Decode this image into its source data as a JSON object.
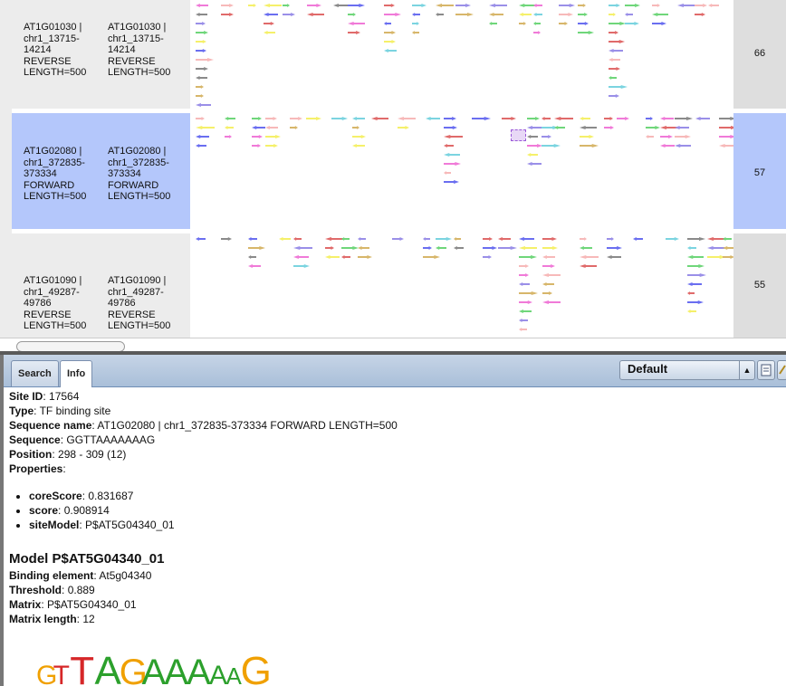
{
  "rows": [
    {
      "col1": [
        "AT1G01030 |",
        "chr1_13715-",
        "14214",
        "REVERSE",
        "LENGTH=500"
      ],
      "col2": [
        "AT1G01030 |",
        "chr1_13715-",
        "14214",
        "REVERSE",
        "LENGTH=500"
      ],
      "score": "66",
      "selected": false
    },
    {
      "col1": [
        "AT1G02080 |",
        "chr1_372835-",
        "373334",
        "FORWARD",
        "LENGTH=500"
      ],
      "col2": [
        "AT1G02080 |",
        "chr1_372835-",
        "373334",
        "FORWARD",
        "LENGTH=500"
      ],
      "score": "57",
      "selected": true
    },
    {
      "col1": [
        "AT1G01090 |",
        "chr1_49287-",
        "49786",
        "REVERSE",
        "LENGTH=500"
      ],
      "col2": [
        "AT1G01090 |",
        "chr1_49287-",
        "49786",
        "REVERSE",
        "LENGTH=500"
      ],
      "score": "55",
      "selected": false
    }
  ],
  "tabs": {
    "search": "Search",
    "info": "Info"
  },
  "combo": {
    "value": "Default"
  },
  "site": {
    "id_label": "Site ID",
    "id": "17564",
    "type_label": "Type",
    "type": "TF binding site",
    "seqname_label": "Sequence name",
    "seqname": "AT1G02080 | chr1_372835-373334 FORWARD LENGTH=500",
    "sequence_label": "Sequence",
    "sequence": "GGTTAAAAAAAG",
    "position_label": "Position",
    "position": "298 - 309 (12)",
    "properties_label": "Properties",
    "properties": [
      {
        "key": "coreScore",
        "value": "0.831687"
      },
      {
        "key": "score",
        "value": "0.908914"
      },
      {
        "key": "siteModel",
        "value": "P$AT5G04340_01"
      }
    ]
  },
  "model": {
    "title": "Model P$AT5G04340_01",
    "binding_label": "Binding element",
    "binding": "At5g04340",
    "threshold_label": "Threshold",
    "threshold": "0.889",
    "matrix_label": "Matrix",
    "matrix": "P$AT5G04340_01",
    "length_label": "Matrix length",
    "length": "12"
  },
  "logo_letters": [
    "G",
    "T",
    "T",
    "A",
    "G",
    "A",
    "A",
    "A",
    "A",
    "A",
    "G"
  ],
  "colors": {
    "selected_row": "#b4c7fb",
    "tab_bar": "#b8cbe2"
  }
}
